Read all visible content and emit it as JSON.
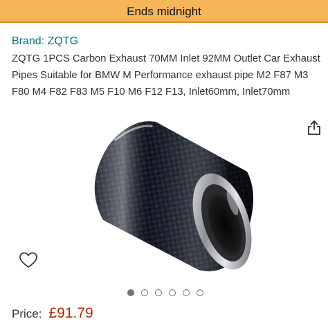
{
  "deal_banner": {
    "text": "Ends midnight"
  },
  "product": {
    "brand_link": "Brand: ZQTG",
    "title": "ZQTG 1PCS Carbon Exhaust 70MM Inlet 92MM Outlet Car Exhaust Pipes Suitable for BMW M Performance exhaust pipe M2 F87 M3 F80 M4 F82 F83 M5 F10 M6 F12 F13, Inlet60mm, Inlet70mm",
    "image": "carbon-exhaust-tip"
  },
  "actions": {
    "share_icon": "share-icon",
    "wishlist_icon": "heart-icon"
  },
  "carousel": {
    "total": 6,
    "active_index": 0
  },
  "price": {
    "label": "Price:",
    "value": "£91.79"
  },
  "colors": {
    "banner_background": "#f5b65a",
    "brand_link": "#007185",
    "price": "#b12704",
    "dot": "#6f7373"
  }
}
